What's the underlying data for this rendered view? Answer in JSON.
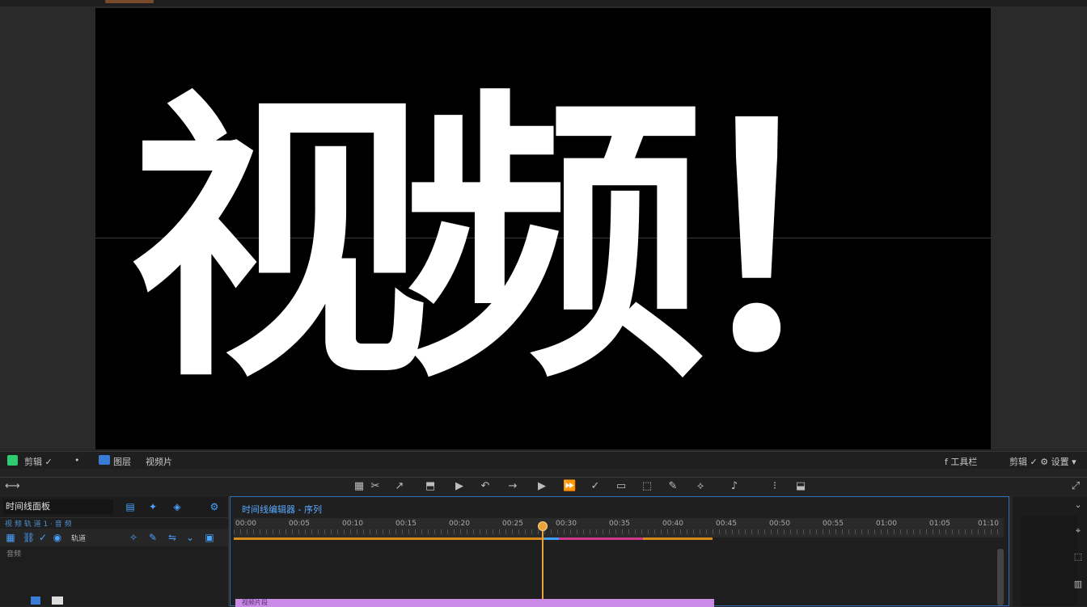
{
  "preview": {
    "title_text": "视频！"
  },
  "status_bar": {
    "left_label": "剪辑 ✓",
    "mark": "•",
    "mode_label": "图层",
    "sub_label": "视频片",
    "right_label1": "f 工具栏",
    "right_label2": "剪辑 ✓  ⚙ 设置 ▾"
  },
  "transport": {
    "icons": [
      "grid-icon",
      "cut-icon",
      "ripple-icon",
      "marker-icon",
      "play-icon",
      "rewind-icon",
      "arrow-icon",
      "play-main-icon",
      "forward-icon",
      "check-icon",
      "rect-icon",
      "frame-icon",
      "pen-icon",
      "blade-icon",
      "audio-icon",
      "more-icon",
      "export-icon"
    ],
    "glyphs": [
      "▦",
      "✂",
      "↗",
      "⬒",
      "▶",
      "↶",
      "→",
      "▶",
      "⏩",
      "✓",
      "▭",
      "⬚",
      "✎",
      "⟡",
      "♪",
      "⁝",
      "⬓"
    ]
  },
  "left_panel": {
    "name": "时间线面板",
    "sub": "视 频 轨 道 1 · 音 频",
    "tool_label": "轨道",
    "label3": "音频",
    "icons": [
      "folder-icon",
      "sparkle-icon",
      "layers-icon",
      "settings-icon"
    ]
  },
  "timeline": {
    "title": "时间线编辑器 - 序列",
    "ticks": [
      "00:00",
      "00:05",
      "00:10",
      "00:15",
      "00:20",
      "00:25",
      "00:30",
      "00:35",
      "00:40",
      "00:45",
      "00:50",
      "00:55",
      "01:00",
      "01:05",
      "01:10"
    ],
    "clip_label": "视频片段"
  },
  "colors": {
    "accent": "#2f6db5",
    "playhead": "#e8a23a",
    "clip": "#c98be6",
    "pink": "#d0378f",
    "orange": "#d38a1b",
    "green": "#2ecc71"
  }
}
